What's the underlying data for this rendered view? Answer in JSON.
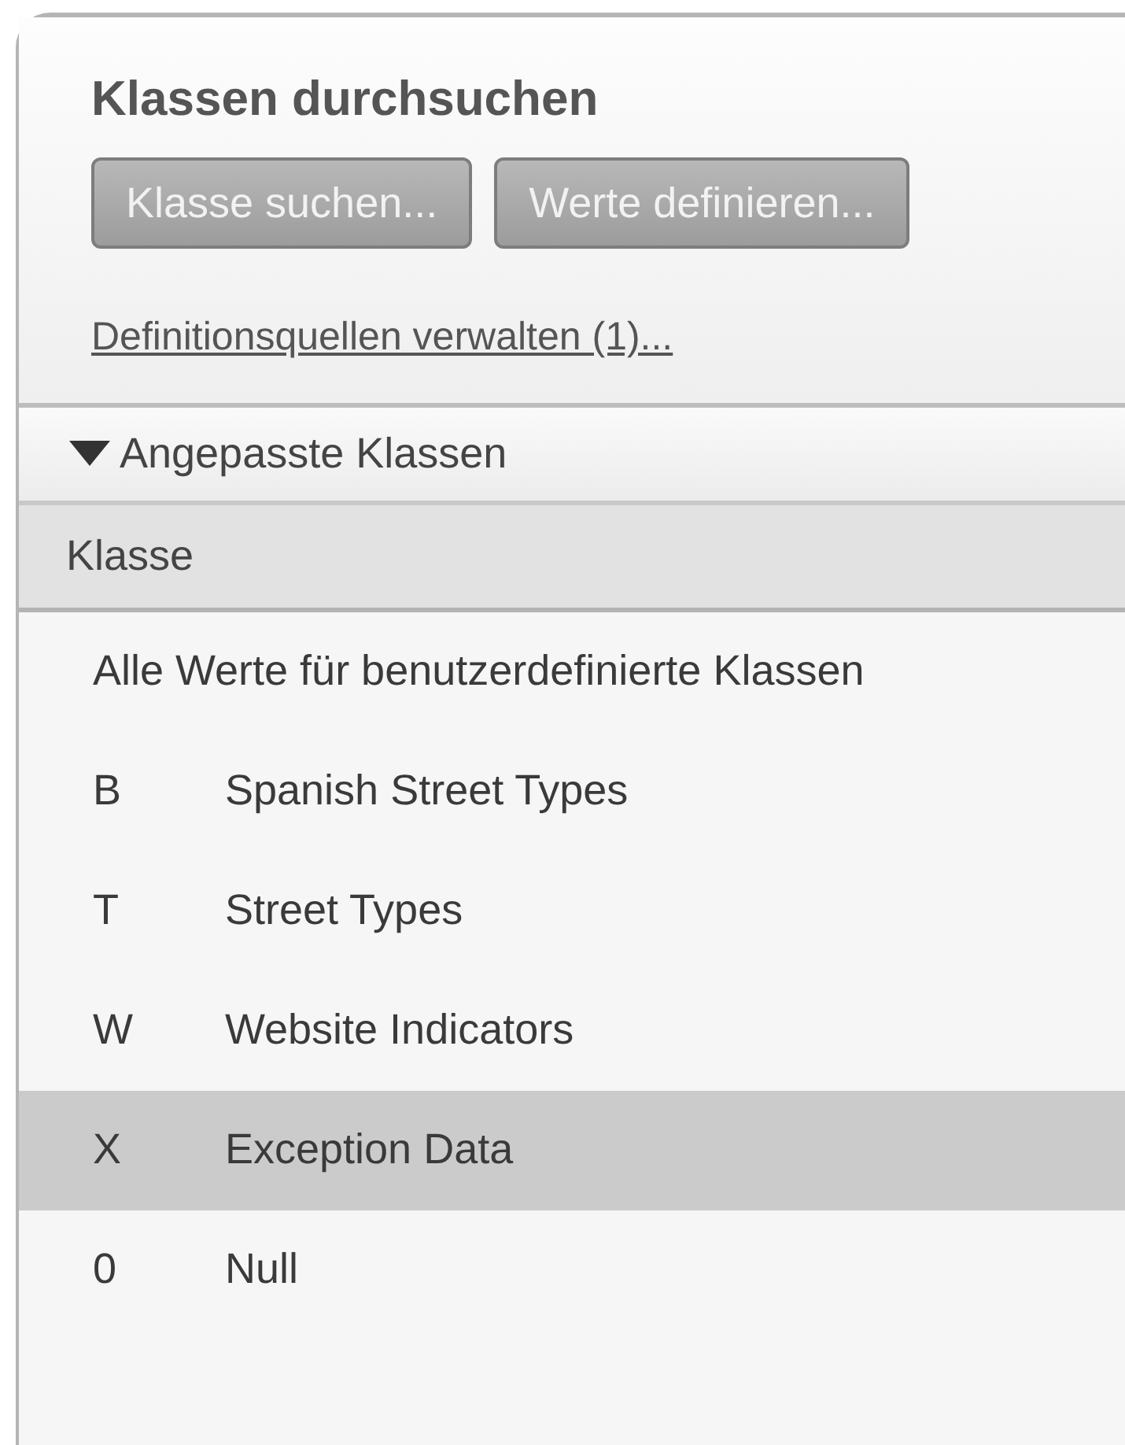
{
  "panel": {
    "title": "Klassen durchsuchen",
    "buttons": [
      "Klasse suchen...",
      "Werte definieren..."
    ],
    "link": "Definitionsquellen verwalten (1)..."
  },
  "section": {
    "label": "Angepasste Klassen",
    "expanded": true
  },
  "table": {
    "columns": [
      "Klasse"
    ],
    "rows": [
      {
        "code": "",
        "name": "Alle Werte für benutzerdefinierte Klassen",
        "selected": false
      },
      {
        "code": "B",
        "name": "Spanish Street Types",
        "selected": false
      },
      {
        "code": "T",
        "name": "Street Types",
        "selected": false
      },
      {
        "code": "W",
        "name": "Website Indicators",
        "selected": false
      },
      {
        "code": "X",
        "name": "Exception Data",
        "selected": true
      },
      {
        "code": "0",
        "name": "Null",
        "selected": false
      }
    ]
  }
}
